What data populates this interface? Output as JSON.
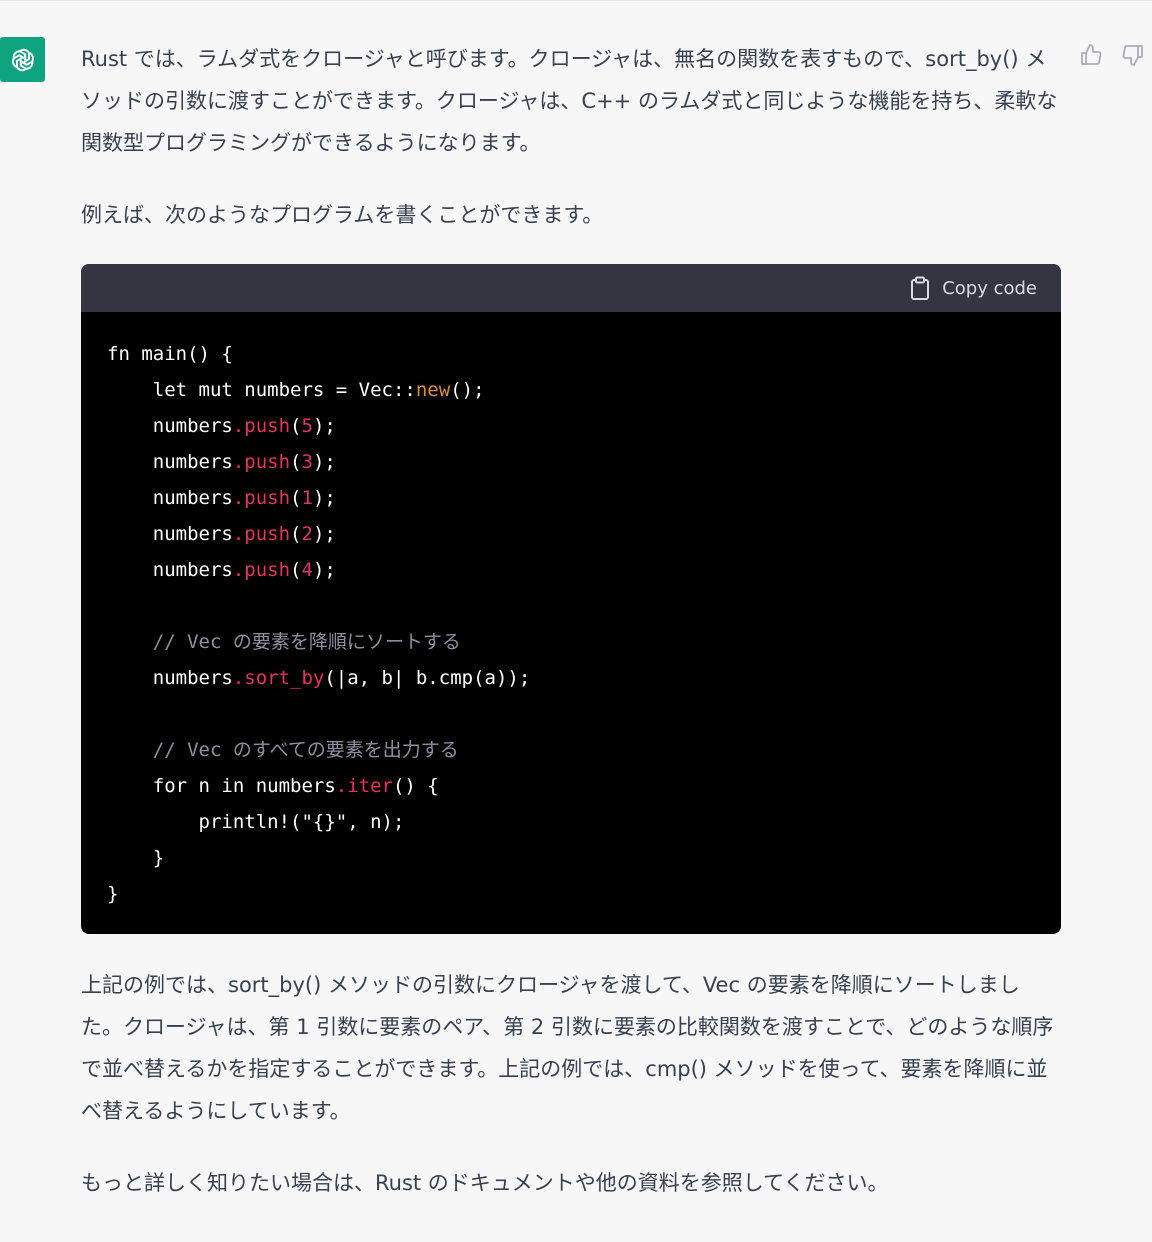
{
  "chat": {
    "assistant_avatar": "openai-logo-icon",
    "feedback": {
      "thumbs_up": "thumbs-up-icon",
      "thumbs_down": "thumbs-down-icon"
    },
    "paragraphs": [
      "Rust では、ラムダ式をクロージャと呼びます。クロージャは、無名の関数を表すもので、sort_by() メソッドの引数に渡すことができます。クロージャは、C++ のラムダ式と同じような機能を持ち、柔軟な関数型プログラミングができるようになります。",
      "例えば、次のようなプログラムを書くことができます。"
    ],
    "code_block": {
      "copy_label": "Copy code",
      "copy_icon": "clipboard-icon",
      "lines": [
        [
          {
            "t": "fn main() {",
            "c": ""
          }
        ],
        [
          {
            "t": "    let mut numbers = Vec::",
            "c": ""
          },
          {
            "t": "new",
            "c": "new"
          },
          {
            "t": "();",
            "c": ""
          }
        ],
        [
          {
            "t": "    numbers",
            "c": ""
          },
          {
            "t": ".push",
            "c": "method"
          },
          {
            "t": "(",
            "c": ""
          },
          {
            "t": "5",
            "c": "num"
          },
          {
            "t": ");",
            "c": ""
          }
        ],
        [
          {
            "t": "    numbers",
            "c": ""
          },
          {
            "t": ".push",
            "c": "method"
          },
          {
            "t": "(",
            "c": ""
          },
          {
            "t": "3",
            "c": "num"
          },
          {
            "t": ");",
            "c": ""
          }
        ],
        [
          {
            "t": "    numbers",
            "c": ""
          },
          {
            "t": ".push",
            "c": "method"
          },
          {
            "t": "(",
            "c": ""
          },
          {
            "t": "1",
            "c": "num"
          },
          {
            "t": ");",
            "c": ""
          }
        ],
        [
          {
            "t": "    numbers",
            "c": ""
          },
          {
            "t": ".push",
            "c": "method"
          },
          {
            "t": "(",
            "c": ""
          },
          {
            "t": "2",
            "c": "num"
          },
          {
            "t": ");",
            "c": ""
          }
        ],
        [
          {
            "t": "    numbers",
            "c": ""
          },
          {
            "t": ".push",
            "c": "method"
          },
          {
            "t": "(",
            "c": ""
          },
          {
            "t": "4",
            "c": "num"
          },
          {
            "t": ");",
            "c": ""
          }
        ],
        [
          {
            "t": "",
            "c": ""
          }
        ],
        [
          {
            "t": "    // Vec の要素を降順にソートする",
            "c": "comment"
          }
        ],
        [
          {
            "t": "    numbers",
            "c": ""
          },
          {
            "t": ".sort_by",
            "c": "method"
          },
          {
            "t": "(|a, b| b.cmp(a));",
            "c": ""
          }
        ],
        [
          {
            "t": "",
            "c": ""
          }
        ],
        [
          {
            "t": "    // Vec のすべての要素を出力する",
            "c": "comment"
          }
        ],
        [
          {
            "t": "    for n in numbers",
            "c": ""
          },
          {
            "t": ".iter",
            "c": "method"
          },
          {
            "t": "() {",
            "c": ""
          }
        ],
        [
          {
            "t": "        println!(\"{}\", n);",
            "c": ""
          }
        ],
        [
          {
            "t": "    }",
            "c": ""
          }
        ],
        [
          {
            "t": "}",
            "c": ""
          }
        ]
      ]
    },
    "after_paragraphs": [
      "上記の例では、sort_by() メソッドの引数にクロージャを渡して、Vec の要素を降順にソートしました。クロージャは、第 1 引数に要素のペア、第 2 引数に要素の比較関数を渡すことで、どのような順序で並べ替えるかを指定することができます。上記の例では、cmp() メソッドを使って、要素を降順に並べ替えるようにしています。",
      "もっと詳しく知りたい場合は、Rust のドキュメントや他の資料を参照してください。"
    ]
  },
  "colors": {
    "background": "#f7f7f8",
    "avatar_bg": "#10a37f",
    "code_header_bg": "#343541",
    "code_bg": "#000000",
    "method": "#e9305f",
    "number": "#df3079",
    "new_keyword": "#df8d33",
    "comment": "#8e8ea0"
  }
}
